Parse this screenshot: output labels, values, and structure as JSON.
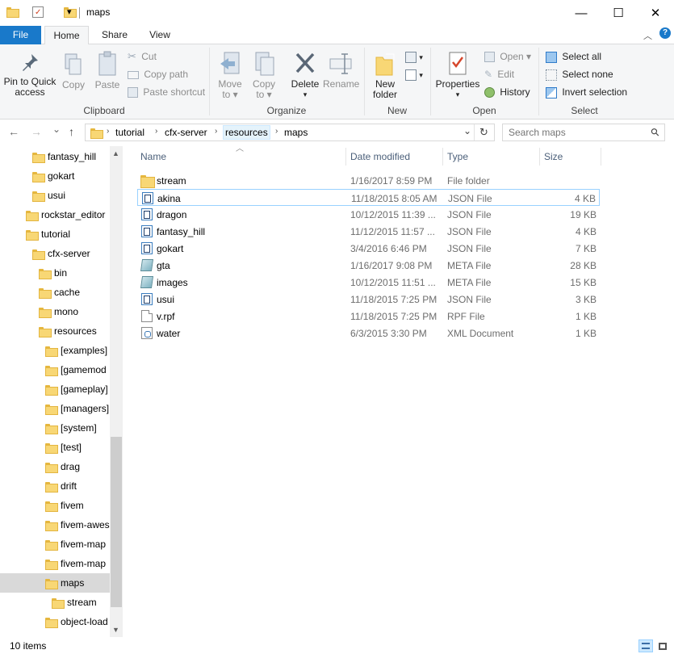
{
  "window": {
    "title": "maps",
    "minimize_glyph": "—",
    "maximize_glyph": "☐",
    "close_glyph": "✕",
    "qa_dropdown_glyph": "▾"
  },
  "ribbon_tabs": {
    "file": "File",
    "home": "Home",
    "share": "Share",
    "view": "View",
    "help_glyph": "?",
    "collapse_glyph": "︿"
  },
  "clipboard": {
    "label": "Clipboard",
    "pin_to_quick_access_line1": "Pin to Quick",
    "pin_to_quick_access_line2": "access",
    "copy": "Copy",
    "paste": "Paste",
    "cut": "Cut",
    "copy_path": "Copy path",
    "paste_shortcut": "Paste shortcut"
  },
  "organize": {
    "label": "Organize",
    "move_to_line1": "Move",
    "move_to_line2": "to ▾",
    "copy_to_line1": "Copy",
    "copy_to_line2": "to ▾",
    "delete": "Delete",
    "delete_arrow": "▾",
    "rename": "Rename"
  },
  "new": {
    "label": "New",
    "new_folder_line1": "New",
    "new_folder_line2": "folder"
  },
  "open": {
    "label": "Open",
    "properties": "Properties",
    "properties_arrow": "▾",
    "open": "Open ▾",
    "edit": "Edit",
    "history": "History"
  },
  "select": {
    "label": "Select",
    "select_all": "Select all",
    "select_none": "Select none",
    "invert_selection": "Invert selection"
  },
  "nav": {
    "back_glyph": "←",
    "forward_glyph": "→",
    "recent_glyph": "⌄",
    "up_glyph": "↑",
    "breadcrumb": [
      "tutorial",
      "cfx-server",
      "resources",
      "maps"
    ],
    "dropdown_glyph": "⌄",
    "refresh_glyph": "↻",
    "search_placeholder": "Search maps",
    "search_glyph": "⚲"
  },
  "tree": [
    {
      "label": "fantasy_hill",
      "indent": 2,
      "selected": false
    },
    {
      "label": "gokart",
      "indent": 2,
      "selected": false
    },
    {
      "label": "usui",
      "indent": 2,
      "selected": false
    },
    {
      "label": "rockstar_editor",
      "indent": 1,
      "selected": false
    },
    {
      "label": "tutorial",
      "indent": 1,
      "selected": false
    },
    {
      "label": "cfx-server",
      "indent": 2,
      "selected": false
    },
    {
      "label": "bin",
      "indent": 3,
      "selected": false
    },
    {
      "label": "cache",
      "indent": 3,
      "selected": false
    },
    {
      "label": "mono",
      "indent": 3,
      "selected": false
    },
    {
      "label": "resources",
      "indent": 3,
      "selected": false
    },
    {
      "label": "[examples]",
      "indent": 4,
      "selected": false
    },
    {
      "label": "[gamemod",
      "indent": 4,
      "selected": false
    },
    {
      "label": "[gameplay]",
      "indent": 4,
      "selected": false
    },
    {
      "label": "[managers]",
      "indent": 4,
      "selected": false
    },
    {
      "label": "[system]",
      "indent": 4,
      "selected": false
    },
    {
      "label": "[test]",
      "indent": 4,
      "selected": false
    },
    {
      "label": "drag",
      "indent": 4,
      "selected": false
    },
    {
      "label": "drift",
      "indent": 4,
      "selected": false
    },
    {
      "label": "fivem",
      "indent": 4,
      "selected": false
    },
    {
      "label": "fivem-awes",
      "indent": 4,
      "selected": false
    },
    {
      "label": "fivem-map",
      "indent": 4,
      "selected": false
    },
    {
      "label": "fivem-map",
      "indent": 4,
      "selected": false
    },
    {
      "label": "maps",
      "indent": 4,
      "selected": true
    },
    {
      "label": "stream",
      "indent": 5,
      "selected": false
    },
    {
      "label": "object-load",
      "indent": 4,
      "selected": false
    }
  ],
  "scroll": {
    "up_glyph": "▲",
    "down_glyph": "▼"
  },
  "columns": {
    "name": "Name",
    "date": "Date modified",
    "type": "Type",
    "size": "Size",
    "sort_glyph": "︿"
  },
  "files": [
    {
      "name": "stream",
      "date": "1/16/2017 8:59 PM",
      "type": "File folder",
      "size": "",
      "icon": "folder-icon"
    },
    {
      "name": "akina",
      "date": "11/18/2015 8:05 AM",
      "type": "JSON File",
      "size": "4 KB",
      "icon": "json-file-icon"
    },
    {
      "name": "dragon",
      "date": "10/12/2015 11:39 ...",
      "type": "JSON File",
      "size": "19 KB",
      "icon": "json-file-icon"
    },
    {
      "name": "fantasy_hill",
      "date": "11/12/2015 11:57 ...",
      "type": "JSON File",
      "size": "4 KB",
      "icon": "json-file-icon"
    },
    {
      "name": "gokart",
      "date": "3/4/2016 6:46 PM",
      "type": "JSON File",
      "size": "7 KB",
      "icon": "json-file-icon"
    },
    {
      "name": "gta",
      "date": "1/16/2017 9:08 PM",
      "type": "META File",
      "size": "28 KB",
      "icon": "meta-file-icon"
    },
    {
      "name": "images",
      "date": "10/12/2015 11:51 ...",
      "type": "META File",
      "size": "15 KB",
      "icon": "meta-file-icon"
    },
    {
      "name": "usui",
      "date": "11/18/2015 7:25 PM",
      "type": "JSON File",
      "size": "3 KB",
      "icon": "json-file-icon"
    },
    {
      "name": "v.rpf",
      "date": "11/18/2015 7:25 PM",
      "type": "RPF File",
      "size": "1 KB",
      "icon": "rpf-file-icon"
    },
    {
      "name": "water",
      "date": "6/3/2015 3:30 PM",
      "type": "XML Document",
      "size": "1 KB",
      "icon": "xml-file-icon"
    }
  ],
  "status": {
    "item_count": "10 items"
  },
  "colors": {
    "accent": "#1979ca",
    "folder": "#f8d775",
    "selection": "#cce8ff"
  }
}
